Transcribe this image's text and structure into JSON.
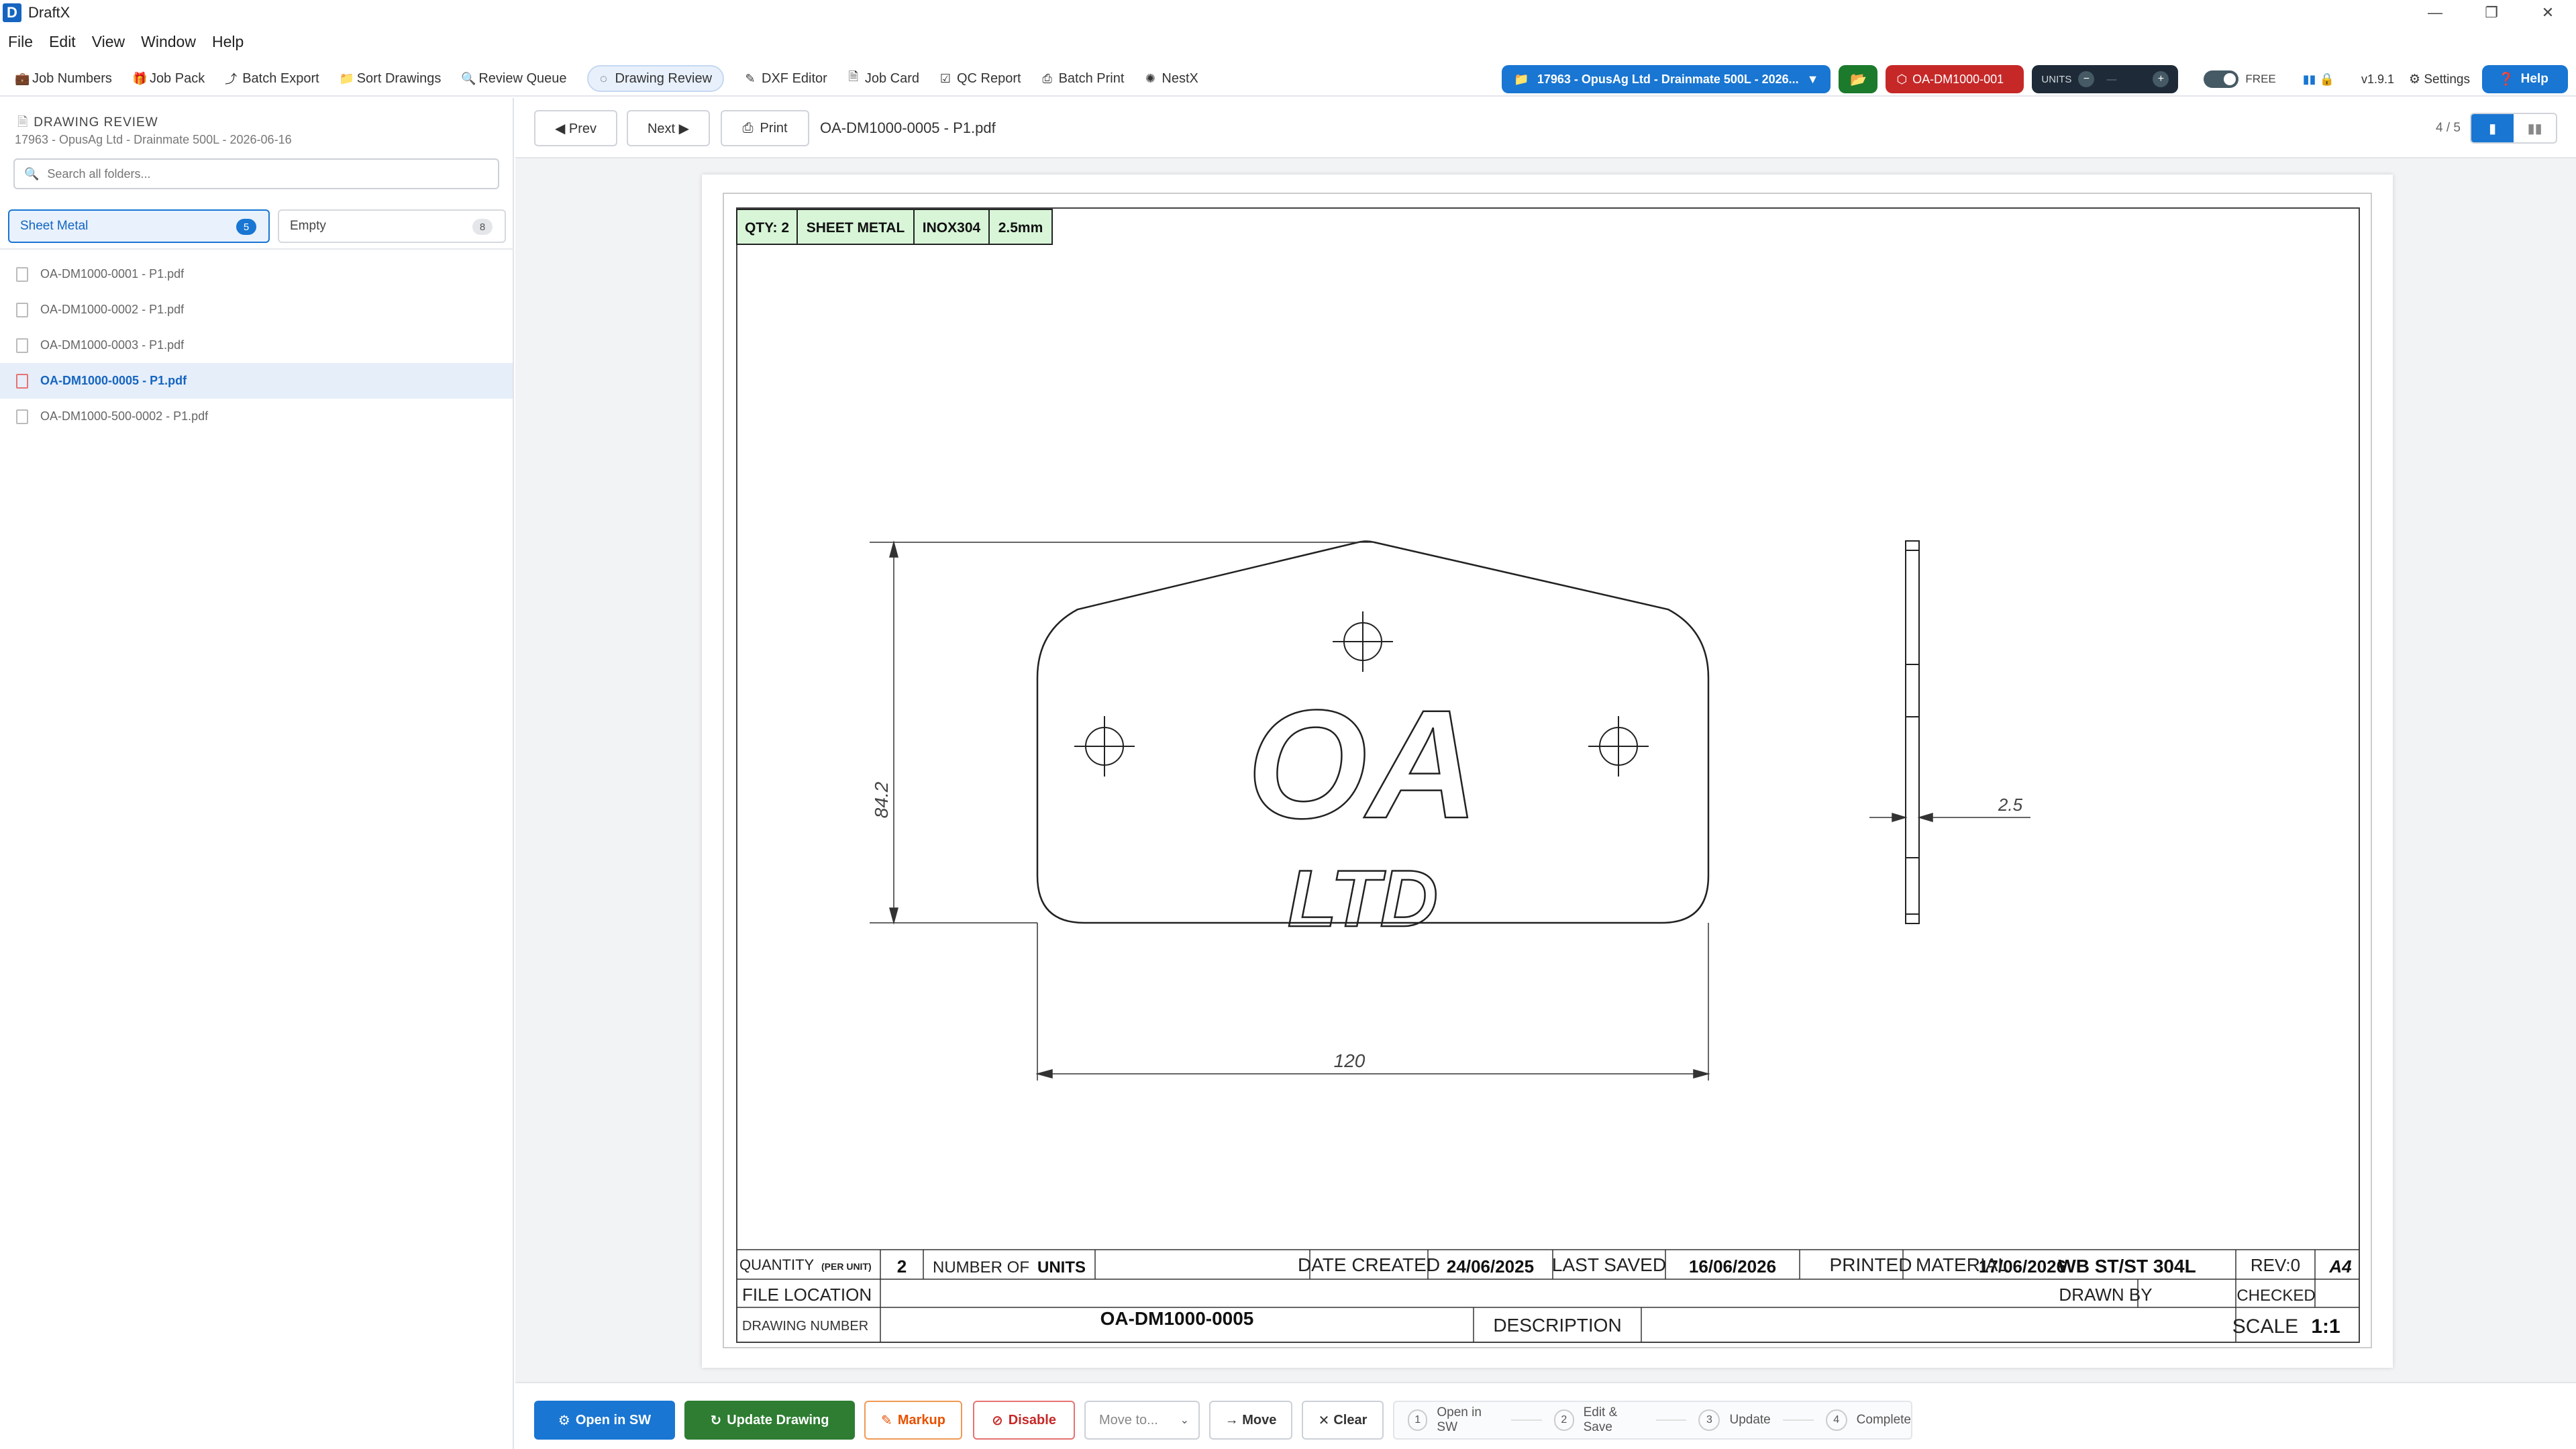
{
  "window": {
    "app_name": "DraftX",
    "logo_letter": "D"
  },
  "menu": [
    "File",
    "Edit",
    "View",
    "Window",
    "Help"
  ],
  "toolbar": {
    "items": [
      {
        "label": "Job Numbers",
        "icon": "briefcase-icon",
        "glyph": "💼"
      },
      {
        "label": "Job Pack",
        "icon": "package-icon",
        "glyph": "🎁"
      },
      {
        "label": "Batch Export",
        "icon": "export-icon",
        "glyph": "⤴"
      },
      {
        "label": "Sort Drawings",
        "icon": "folder-icon",
        "glyph": "📁"
      },
      {
        "label": "Review Queue",
        "icon": "magnifier-icon",
        "glyph": "🔍"
      },
      {
        "label": "Drawing Review",
        "icon": "review-icon",
        "glyph": "◌"
      },
      {
        "label": "DXF Editor",
        "icon": "pencil-icon",
        "glyph": "✎"
      },
      {
        "label": "Job Card",
        "icon": "document-icon",
        "glyph": "🗎"
      },
      {
        "label": "QC Report",
        "icon": "check-icon",
        "glyph": "☑"
      },
      {
        "label": "Batch Print",
        "icon": "printer-icon",
        "glyph": "⎙"
      },
      {
        "label": "NestX",
        "icon": "sparkle-icon",
        "glyph": "✺"
      }
    ],
    "active_index": 5,
    "job_selector": "17963 - OpusAg Ltd - Drainmate 500L - 2026...",
    "part_label": "OA-DM1000-001",
    "units_label": "UNITS",
    "units_minus": "−",
    "units_value": "—",
    "units_plus": "+",
    "free_label": "FREE",
    "version": "v1.9.1",
    "settings_label": "Settings",
    "help_label": "Help"
  },
  "sidebar": {
    "heading": "DRAWING REVIEW",
    "subtitle": "17963 - OpusAg Ltd - Drainmate 500L - 2026-06-16",
    "search_placeholder": "Search all folders...",
    "tabs": [
      {
        "label": "Sheet Metal",
        "count": "5"
      },
      {
        "label": "Empty",
        "count": "8"
      }
    ],
    "files": [
      "OA-DM1000-0001 - P1.pdf",
      "OA-DM1000-0002 - P1.pdf",
      "OA-DM1000-0003 - P1.pdf",
      "OA-DM1000-0005 - P1.pdf",
      "OA-DM1000-500-0002 - P1.pdf"
    ],
    "selected_index": 3
  },
  "viewer": {
    "prev_label": "◀ Prev",
    "next_label": "Next ▶",
    "print_label": "Print",
    "document_name": "OA-DM1000-0005 - P1.pdf",
    "page_indicator": "4 / 5"
  },
  "drawing": {
    "tag_qty": "QTY: 2",
    "tag_type": "SHEET METAL",
    "tag_material": "INOX304",
    "tag_thickness": "2.5mm",
    "logo_text": "OA",
    "logo_subtext": "LTD",
    "dim_width": "120",
    "dim_height": "84.2",
    "dim_thickness": "2.5",
    "title_block": {
      "quantity_label": "QUANTITY",
      "quantity_sub": "(PER UNIT)",
      "quantity_value": "2",
      "units_label_a": "NUMBER OF",
      "units_label_b": "UNITS",
      "date_created_label": "DATE CREATED",
      "date_created": "24/06/2025",
      "last_saved_label": "LAST SAVED",
      "last_saved": "16/06/2026",
      "printed_label": "PRINTED",
      "printed": "17/06/2026",
      "material_label": "MATERIAL",
      "material": "WB ST/ST 304L",
      "rev": "REV:0",
      "size": "A4",
      "file_location_label": "FILE LOCATION",
      "drawn_by_label": "DRAWN BY",
      "checked_label": "CHECKED",
      "drawing_number_label": "DRAWING NUMBER",
      "drawing_number": "OA-DM1000-0005",
      "description_label": "DESCRIPTION",
      "scale_label": "SCALE",
      "scale": "1:1"
    },
    "colors": {
      "tag_fill": "#d8f5d8",
      "line": "#222222"
    }
  },
  "actions": {
    "open_sw": "Open in SW",
    "update_drawing": "Update Drawing",
    "markup": "Markup",
    "disable": "Disable",
    "move_placeholder": "Move to...",
    "move": "→ Move",
    "clear": "Clear",
    "steps": [
      {
        "num": "1",
        "label": "Open in SW"
      },
      {
        "num": "2",
        "label": "Edit & Save"
      },
      {
        "num": "3",
        "label": "Update"
      },
      {
        "num": "4",
        "label": "Complete"
      }
    ]
  },
  "colors": {
    "primary": "#1976d2",
    "success": "#2e7d32",
    "danger": "#c62828",
    "warning": "#e65100",
    "dark_pill": "#1e2a38"
  }
}
